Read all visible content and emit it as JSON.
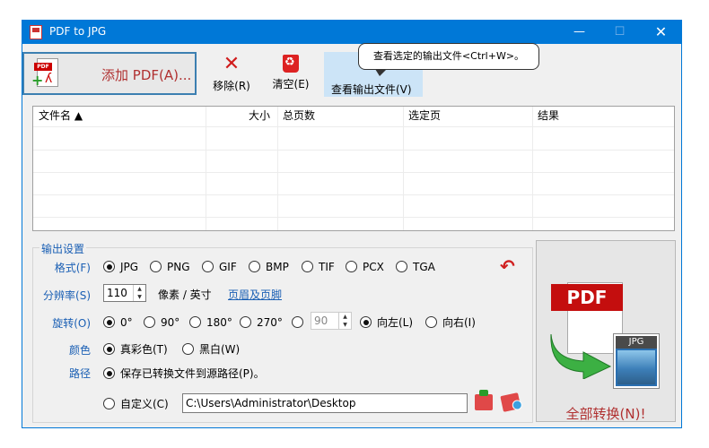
{
  "window": {
    "title": "PDF to JPG"
  },
  "toolbar": {
    "add_label": "添加 PDF(A)...",
    "remove_label": "移除(R)",
    "clear_label": "清空(E)",
    "view_output_label": "查看输出文件(V)",
    "tooltip": "查看选定的输出文件<Ctrl+W>。"
  },
  "file_list": {
    "columns": [
      "文件名 ▲",
      "大小",
      "总页数",
      "选定页",
      "结果"
    ],
    "rows": []
  },
  "settings": {
    "legend": "输出设置",
    "format_label": "格式(F)",
    "formats": [
      "JPG",
      "PNG",
      "GIF",
      "BMP",
      "TIF",
      "PCX",
      "TGA"
    ],
    "format_selected": "JPG",
    "resolution_label": "分辨率(S)",
    "resolution_value": "110",
    "resolution_unit": "像素 / 英寸",
    "header_footer_link": "页眉及页脚",
    "rotation_label": "旋转(O)",
    "rotations": [
      "0°",
      "90°",
      "180°",
      "270°"
    ],
    "rotation_selected": "0°",
    "rotation_custom_value": "90",
    "rotate_left": "向左(L)",
    "rotate_right": "向右(I)",
    "color_label": "颜色",
    "color_options": [
      "真彩色(T)",
      "黑白(W)"
    ],
    "color_selected": "真彩色(T)",
    "path_label": "路径",
    "path_source": "保存已转换文件到源路径(P)。",
    "path_custom": "自定义(C)",
    "path_value": "C:\\Users\\Administrator\\Desktop"
  },
  "convert": {
    "pdf_tag": "PDF",
    "jpg_tag": "JPG",
    "label": "全部转换(N)!"
  },
  "colors": {
    "titlebar": "#0078d7",
    "accent_red": "#b03030",
    "label_blue": "#1a5fb4"
  }
}
